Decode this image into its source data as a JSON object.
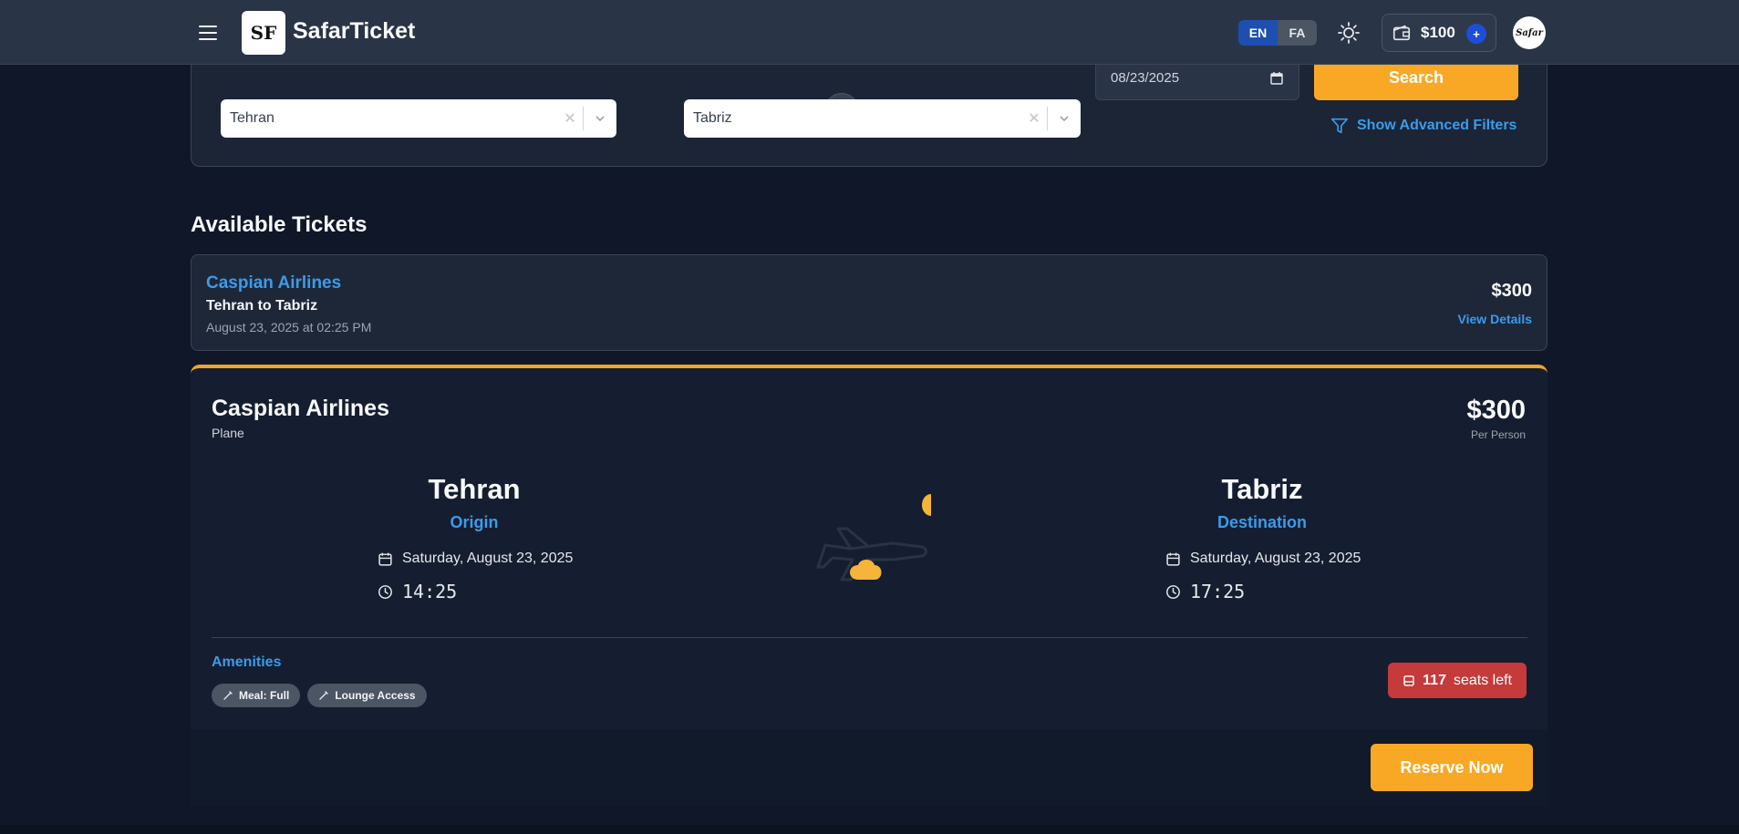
{
  "header": {
    "brand": "SafarTicket",
    "logo_text": "SF",
    "lang_en": "EN",
    "lang_fa": "FA",
    "wallet_amount": "$100",
    "wallet_add": "+",
    "avatar_text": "Safar"
  },
  "search": {
    "origin": "Tehran",
    "destination": "Tabriz",
    "date": "08/23/2025",
    "search_label": "Search",
    "advanced_label": "Show Advanced Filters"
  },
  "section_title": "Available Tickets",
  "summary": {
    "airline": "Caspian Airlines",
    "route": "Tehran to Tabriz",
    "when": "August 23, 2025 at 02:25 PM",
    "price": "$300",
    "details_label": "View Details"
  },
  "detail": {
    "airline": "Caspian Airlines",
    "mode": "Plane",
    "price": "$300",
    "per_person": "Per Person",
    "origin": {
      "name": "Tehran",
      "role": "Origin",
      "date": "Saturday, August 23, 2025",
      "time": "14:25"
    },
    "destination": {
      "name": "Tabriz",
      "role": "Destination",
      "date": "Saturday, August 23, 2025",
      "time": "17:25"
    },
    "amenities_title": "Amenities",
    "amenities": [
      "Meal: Full",
      "Lounge Access"
    ],
    "seats_count": "117",
    "seats_label": "seats left",
    "reserve_label": "Reserve Now"
  },
  "colors": {
    "accent": "#3b9bea",
    "orange": "#f9a825",
    "danger": "#c53a3a"
  }
}
